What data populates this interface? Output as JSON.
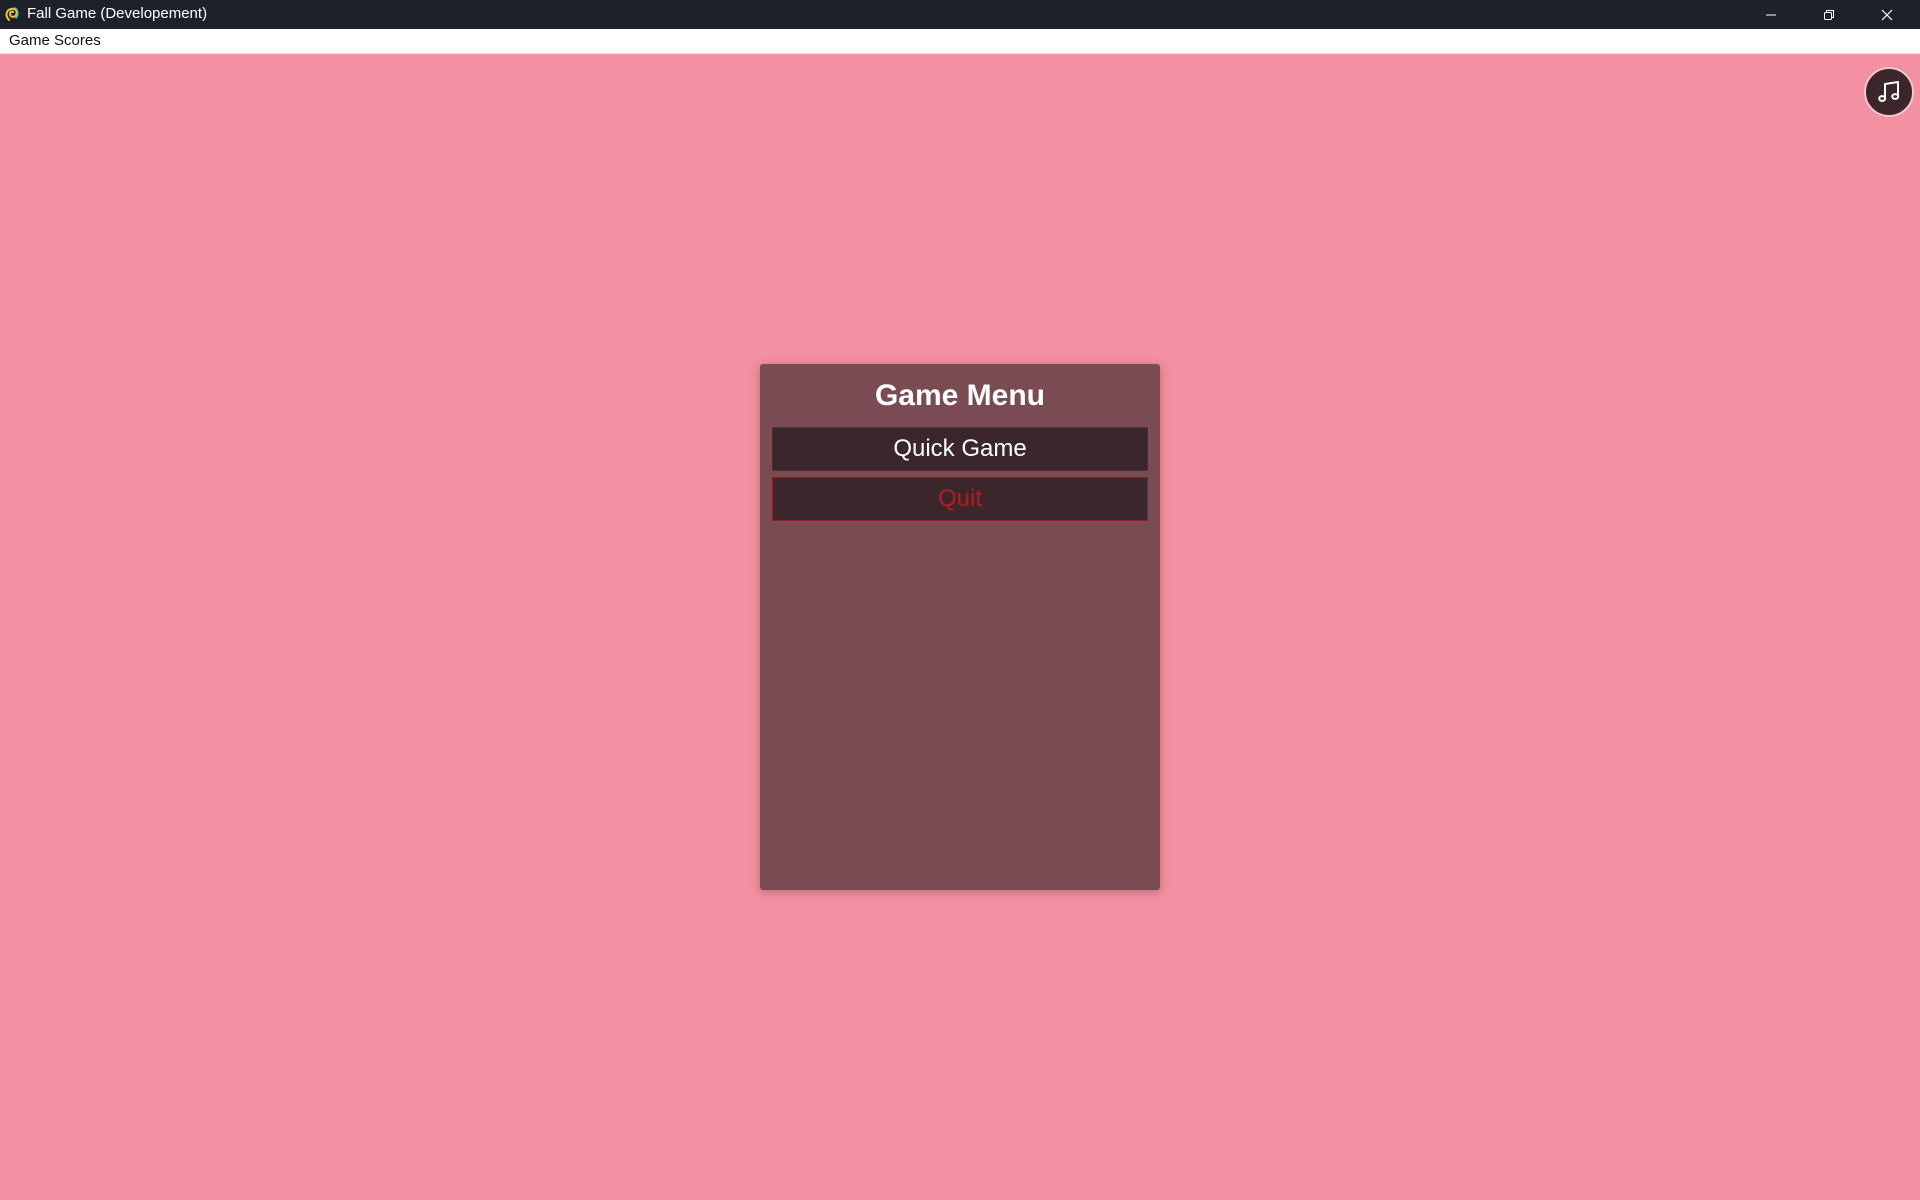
{
  "window": {
    "title": "Fall Game (Developement)",
    "controls": {
      "minimize_icon": "minimize-icon",
      "restore_icon": "restore-icon",
      "close_icon": "close-icon"
    }
  },
  "menubar": {
    "items": [
      {
        "label": "Game Scores"
      }
    ]
  },
  "music_button": {
    "icon": "music-note-icon"
  },
  "game_menu": {
    "title": "Game Menu",
    "buttons": [
      {
        "label": "Quick Game"
      },
      {
        "label": "Quit"
      }
    ]
  },
  "colors": {
    "background": "#f391a2",
    "panel": "#7a4b53",
    "button": "#3b272b",
    "quit_text": "#b31b24",
    "titlebar": "#1f212a"
  }
}
